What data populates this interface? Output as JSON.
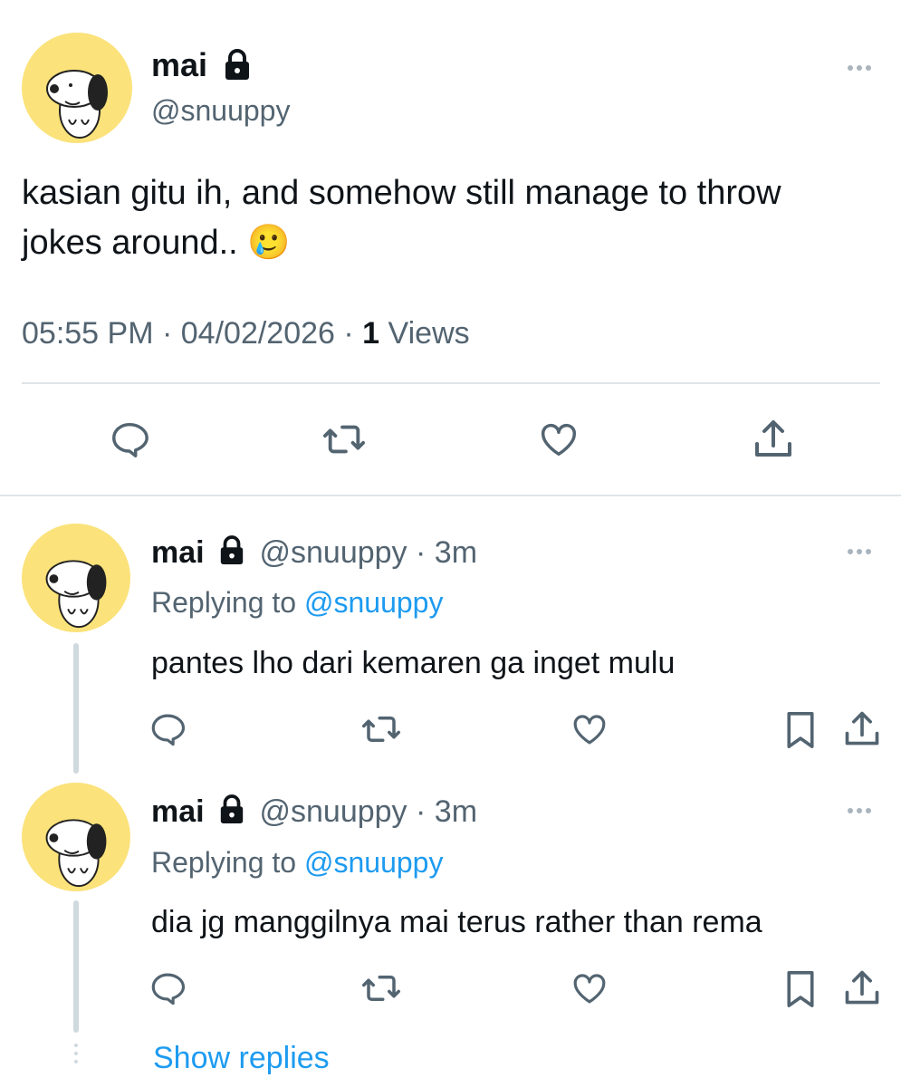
{
  "main_tweet": {
    "display_name": "mai",
    "handle": "@snuuppy",
    "text": "kasian gitu ih, and somehow still manage to throw",
    "text_line2": "jokes around..",
    "emoji": "🥲",
    "time": "05:55 PM",
    "separator": "·",
    "date": "04/02/2026",
    "views_count": "1",
    "views_label": "Views"
  },
  "replies": [
    {
      "display_name": "mai",
      "handle": "@snuuppy",
      "separator": "·",
      "age": "3m",
      "replying_prefix": "Replying to",
      "replying_handle": "@snuuppy",
      "text": "pantes lho dari kemaren ga inget mulu"
    },
    {
      "display_name": "mai",
      "handle": "@snuuppy",
      "separator": "·",
      "age": "3m",
      "replying_prefix": "Replying to",
      "replying_handle": "@snuuppy",
      "text": "dia jg manggilnya mai terus rather than rema"
    }
  ],
  "show_replies_label": "Show replies",
  "icons": [
    "lock-icon",
    "more-icon",
    "reply-icon",
    "retweet-icon",
    "like-icon",
    "share-icon",
    "bookmark-icon",
    "snoopy-avatar"
  ],
  "colors": {
    "accent": "#1d9bf0",
    "muted": "#536471",
    "icon": "#536471",
    "avatar_bg": "#fbe27a",
    "divider": "#cfd9de"
  }
}
